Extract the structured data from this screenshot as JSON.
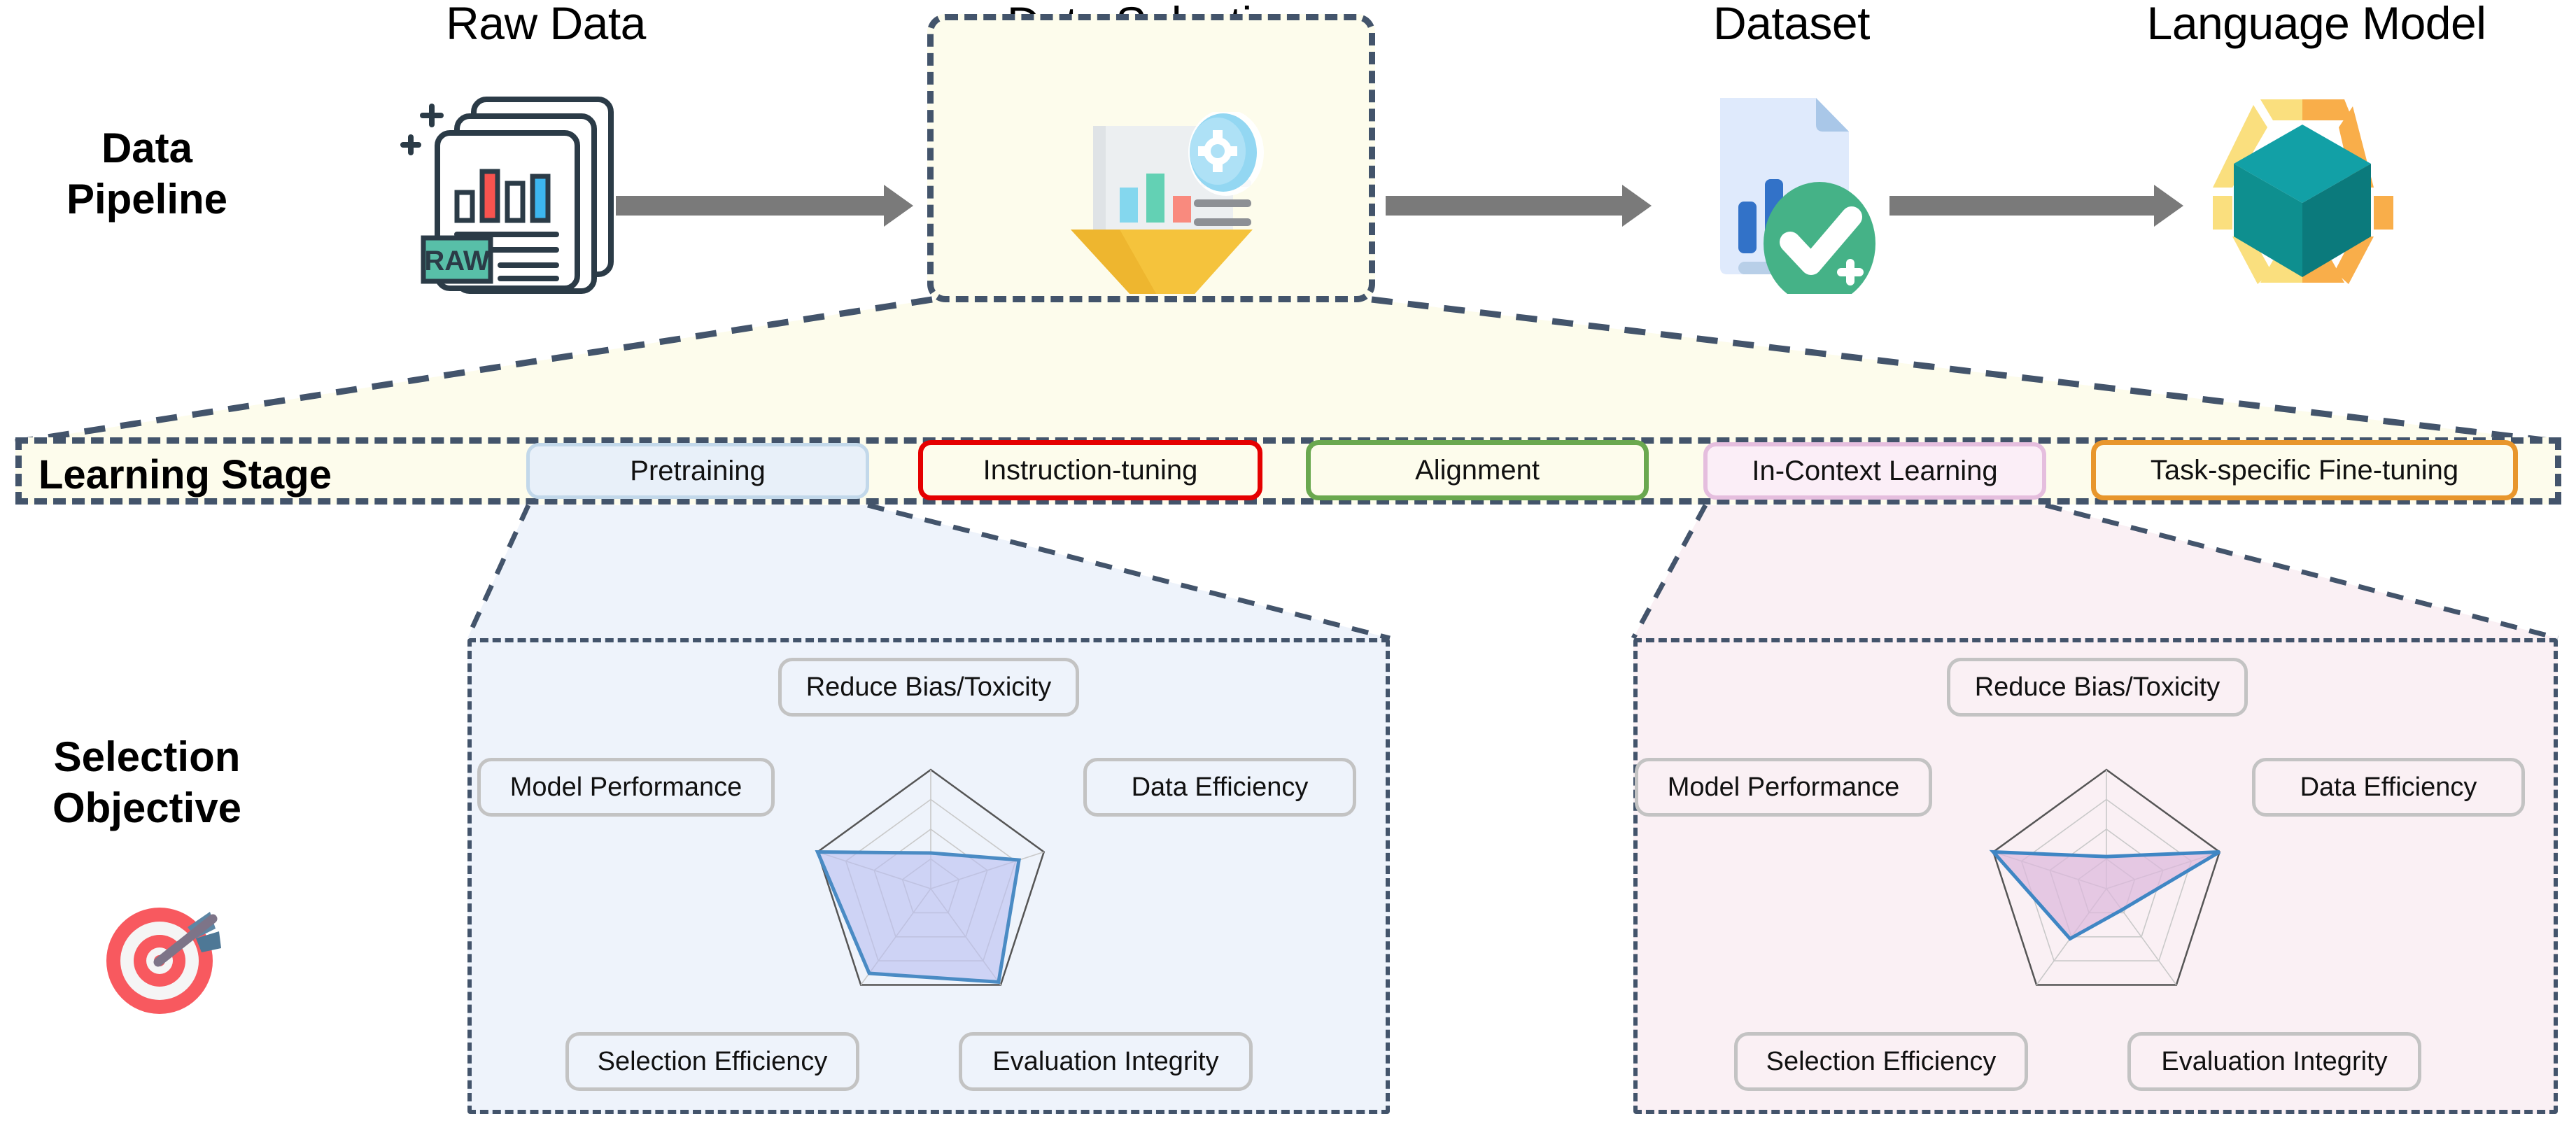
{
  "rows": {
    "pipeline_label": "Data\nPipeline",
    "objective_label": "Selection\nObjective"
  },
  "pipeline": {
    "nodes": [
      {
        "title": "Raw Data",
        "icon": "raw-documents-icon"
      },
      {
        "title": "Data Selection",
        "icon": "funnel-filter-icon"
      },
      {
        "title": "Dataset",
        "icon": "document-checkmark-icon"
      },
      {
        "title": "Language Model",
        "icon": "teal-cube-hexagon-icon"
      }
    ],
    "raw_data_badge": "RAW",
    "arrow_icon": "right-arrow-icon"
  },
  "learning_stage": {
    "label": "Learning Stage",
    "stages": [
      {
        "name": "Pretraining",
        "border": "#c2d8ea",
        "fill": "#e8f0f9"
      },
      {
        "name": "Instruction-tuning",
        "border": "#e50000",
        "fill": "#fdfcec"
      },
      {
        "name": "Alignment",
        "border": "#6aa84f",
        "fill": "#fdfcec"
      },
      {
        "name": "In-Context Learning",
        "border": "#e5bede",
        "fill": "#fbeef7"
      },
      {
        "name": "Task-specific Fine-tuning",
        "border": "#e8962c",
        "fill": "#fdfcec"
      }
    ]
  },
  "selection_objective": {
    "icon": "target-dart-icon",
    "axes": [
      "Reduce Bias/Toxicity",
      "Data Efficiency",
      "Evaluation Integrity",
      "Selection Efficiency",
      "Model  Performance"
    ]
  },
  "chart_data": [
    {
      "type": "radar",
      "title": "Pretraining",
      "categories": [
        "Reduce Bias/Toxicity",
        "Data Efficiency",
        "Evaluation Integrity",
        "Selection Efficiency",
        "Model  Performance"
      ],
      "values": [
        0.3,
        0.78,
        0.97,
        0.88,
        1.0
      ],
      "rlim": [
        0,
        1
      ],
      "rings": 4,
      "grid": true,
      "line_color": "#4a8bc4",
      "fill_color": "#b9bff0",
      "legend": "none"
    },
    {
      "type": "radar",
      "title": "In-Context Learning",
      "categories": [
        "Reduce Bias/Toxicity",
        "Data Efficiency",
        "Evaluation Integrity",
        "Selection Efficiency",
        "Model  Performance"
      ],
      "values": [
        0.27,
        1.0,
        0.22,
        0.52,
        1.0
      ],
      "rlim": [
        0,
        1
      ],
      "rings": 4,
      "grid": true,
      "line_color": "#3f86c4",
      "fill_color": "#dcb8dc",
      "legend": "none"
    }
  ],
  "colors": {
    "dashed_outline": "#43546b",
    "panel_cream": "#fdfcec",
    "arrow_gray": "#7a7a7a",
    "pretrain_panel": "#eef3fb",
    "icl_panel": "#faf0f4"
  }
}
